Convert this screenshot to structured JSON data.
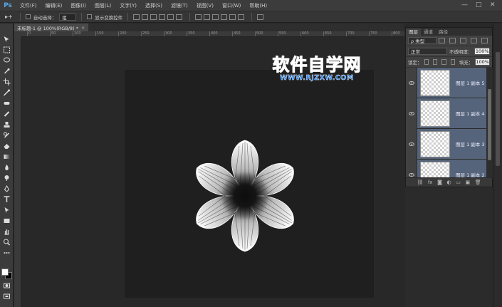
{
  "app": {
    "logo": "Ps"
  },
  "menu": [
    "文件(F)",
    "编辑(E)",
    "图像(I)",
    "图层(L)",
    "文字(Y)",
    "选择(S)",
    "滤镜(T)",
    "视图(V)",
    "窗口(W)",
    "帮助(H)"
  ],
  "window_controls": {
    "minimize": "—",
    "restore": "□",
    "close": "✕"
  },
  "options": {
    "tool_glyph": "▸+",
    "auto_select_label": "自动选择：",
    "auto_select_value": "组",
    "show_transform_label": "显示变换控件"
  },
  "document": {
    "tab_title": "未标题-1 @ 100%(RGB/8) *",
    "close": "×"
  },
  "ruler_ticks": [
    "0",
    "50",
    "100",
    "150",
    "200",
    "250",
    "300",
    "350",
    "400",
    "450",
    "500",
    "550",
    "600",
    "650",
    "700",
    "750",
    "800"
  ],
  "watermark": {
    "title": "软件自学网",
    "url": "WWW.RJZXW.COM"
  },
  "panel": {
    "tabs": [
      "图层",
      "通道",
      "路径"
    ],
    "active_tab": "图层",
    "filter_kind": "ρ 类型",
    "blend_mode": "正常",
    "opacity_label": "不透明度：",
    "opacity_value": "100%",
    "lock_label": "锁定：",
    "fill_label": "填充：",
    "fill_value": "100%",
    "layers": [
      {
        "name": "图层 1 副本 5"
      },
      {
        "name": "图层 1 副本 4"
      },
      {
        "name": "图层 1 副本 3"
      },
      {
        "name": "图层 1 副本 2"
      }
    ]
  },
  "colors": {
    "accent_selected": "#55647a",
    "watermark_blue": "#1e7ff0",
    "canvas_bg": "#1f1f1f"
  }
}
